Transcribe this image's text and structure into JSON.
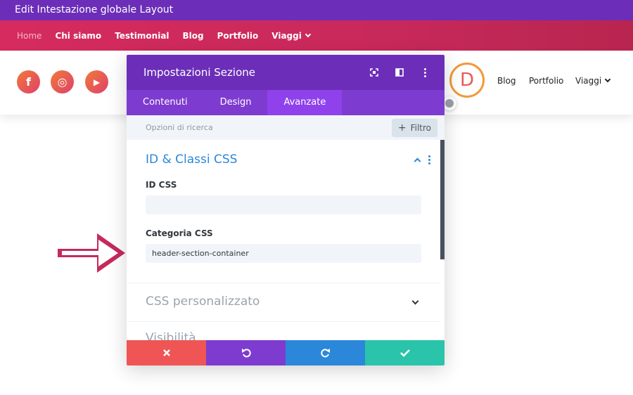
{
  "topbar": {
    "title": "Edit Intestazione globale Layout"
  },
  "menubar": {
    "items": [
      {
        "label": "Home"
      },
      {
        "label": "Chi siamo"
      },
      {
        "label": "Testimonial"
      },
      {
        "label": "Blog"
      },
      {
        "label": "Portfolio"
      },
      {
        "label": "Viaggi"
      }
    ]
  },
  "header": {
    "social": [
      {
        "icon": "facebook-icon",
        "glyph": "f"
      },
      {
        "icon": "instagram-icon",
        "glyph": "◎"
      },
      {
        "icon": "youtube-icon",
        "glyph": "▶"
      }
    ],
    "logo_letter": "D",
    "nav": [
      {
        "label": "Blog"
      },
      {
        "label": "Portfolio"
      },
      {
        "label": "Viaggi"
      }
    ]
  },
  "panel": {
    "title": "Impostazioni Sezione",
    "tabs": [
      {
        "label": "Contenuti"
      },
      {
        "label": "Design"
      },
      {
        "label": "Avanzate"
      }
    ],
    "search_placeholder": "Opzioni di ricerca",
    "filter_label": "Filtro",
    "group_title": "ID & Classi CSS",
    "id_label": "ID CSS",
    "id_value": "",
    "class_label": "Categoria CSS",
    "class_value": "header-section-container",
    "custom_css_title": "CSS personalizzato",
    "visibility_title": "Visibilità"
  },
  "colors": {
    "purple": "#6c2eb9",
    "pink": "#d62b5e",
    "blue": "#2b87da",
    "red": "#ef5555",
    "teal": "#29c4a9"
  }
}
